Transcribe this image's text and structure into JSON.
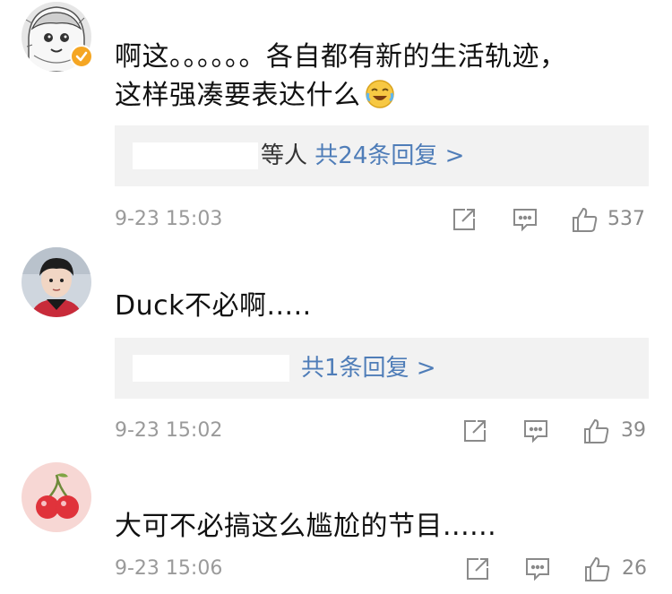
{
  "colors": {
    "link_blue": "#4f7db8",
    "reply_bg": "#f2f2f2",
    "timestamp_gray": "#9a9a9a",
    "icon_gray": "#8a8a8a",
    "verified_badge": "#f5a623"
  },
  "comments": [
    {
      "avatar": "manga-girl-avatar",
      "verified": true,
      "text_line1": "啊这。。。。。。各自都有新的生活轨迹，",
      "text_line2": "这样强凑要表达什么",
      "emoji": "laugh-cry-emoji",
      "reply_people": "等人",
      "reply_count_label": "共24条回复 >",
      "time": "9-23 15:03",
      "likes": "537"
    },
    {
      "avatar": "boy-photo-avatar",
      "verified": false,
      "text_line1": "Duck不必啊.....",
      "reply_count_label": "共1条回复 >",
      "time": "9-23 15:02",
      "likes": "39"
    },
    {
      "avatar": "cherry-avatar",
      "verified": false,
      "text_line1": "大可不必搞这么尴尬的节目......",
      "time": "9-23 15:06",
      "likes": "26"
    }
  ]
}
